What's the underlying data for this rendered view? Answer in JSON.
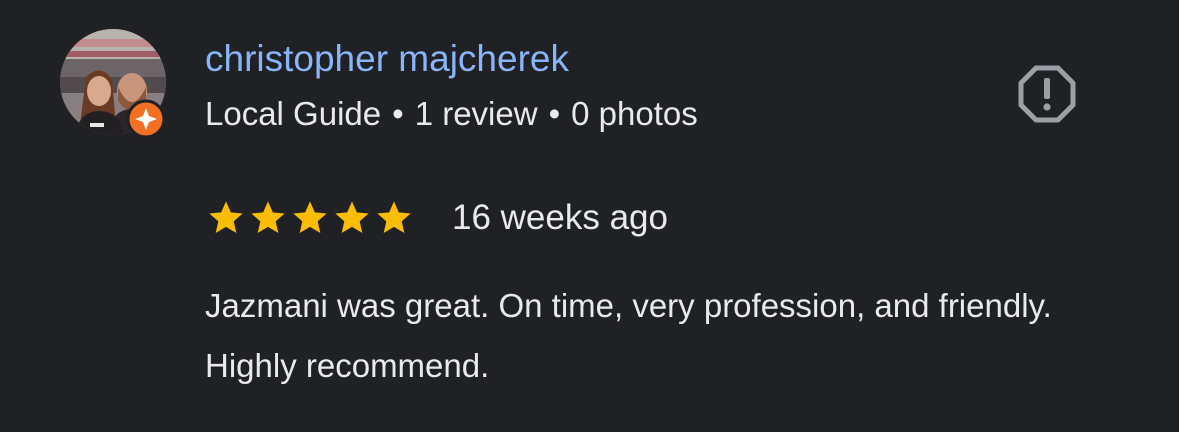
{
  "reviewer": {
    "name": "christopher majcherek",
    "badge_icon": "local-guide-badge-icon",
    "meta": {
      "guide_label": "Local Guide",
      "separator": "•",
      "reviews": "1 review",
      "photos": "0 photos"
    }
  },
  "review": {
    "rating": 5,
    "max_rating": 5,
    "time_ago": "16 weeks ago",
    "text": "Jazmani was great. On time, very profession, and friendly. Highly recommend."
  },
  "actions": {
    "flag_icon": "report-octagon-icon"
  },
  "colors": {
    "background": "#202124",
    "name": "#8ab4f8",
    "text": "#e8eaed",
    "star": "#fbbc04",
    "badge": "#f36f21",
    "flag_icon": "#9aa0a6"
  }
}
